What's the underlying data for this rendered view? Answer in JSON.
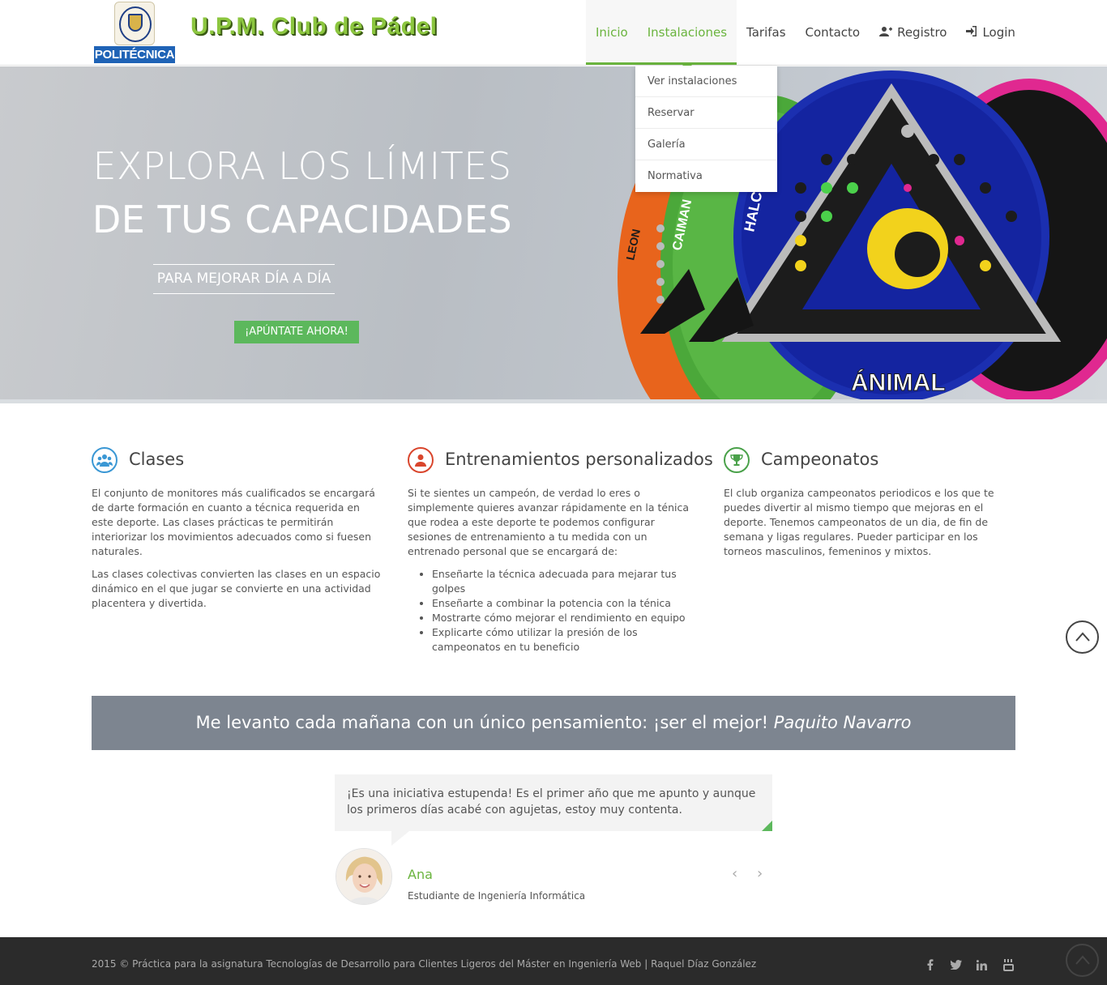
{
  "header": {
    "logo_text": "POLITÉCNICA",
    "brand": "U.P.M. Club de Pádel",
    "nav": [
      {
        "label": "Inicio"
      },
      {
        "label": "Instalaciones"
      },
      {
        "label": "Tarifas"
      },
      {
        "label": "Contacto"
      },
      {
        "label": "Registro",
        "icon": "user-plus-icon"
      },
      {
        "label": "Login",
        "icon": "sign-in-icon"
      }
    ],
    "dropdown": [
      "Ver instalaciones",
      "Reservar",
      "Galería",
      "Normativa"
    ]
  },
  "hero": {
    "title_line1": "EXPLORA LOS LÍMITES",
    "title_line2": "DE TUS CAPACIDADES",
    "subtitle": "PARA MEJORAR DÍA A DÍA",
    "cta": "¡APÚNTATE AHORA!",
    "racquet_brand": "ÁNIMAL",
    "racquet_labels": [
      "LEON",
      "CAIMAN",
      "HALCON"
    ]
  },
  "features": [
    {
      "title": "Clases",
      "icon": "users-icon",
      "color": "#3a97d4",
      "paragraphs": [
        "El conjunto de monitores más cualificados se encargará de darte formación en cuanto a técnica requerida en este deporte. Las clases prácticas te permitirán interiorizar los movimientos adecuados como si fuesen naturales.",
        "Las clases colectivas convierten las clases en un espacio dinámico en el que jugar se convierte en una actividad placentera y divertida."
      ]
    },
    {
      "title": "Entrenamientos personalizados",
      "icon": "user-icon",
      "color": "#d9452c",
      "paragraphs": [
        "Si te sientes un campeón, de verdad lo eres o simplemente quieres avanzar rápidamente en la ténica que rodea a este deporte te podemos configurar sesiones de entrenamiento a tu medida con un entrenado personal que se encargará de:"
      ],
      "list": [
        "Enseñarte la técnica adecuada para mejarar tus golpes",
        "Enseñarte a combinar la potencia con la ténica",
        "Mostrarte cómo mejorar el rendimiento en equipo",
        "Explicarte cómo utilizar la presión de los campeonatos en tu beneficio"
      ]
    },
    {
      "title": "Campeonatos",
      "icon": "trophy-icon",
      "color": "#4aa14a",
      "paragraphs": [
        "El club organiza campeonatos periodicos e los que te puedes divertir al mismo tiempo que mejoras en el deporte. Tenemos campeonatos de un dia, de fin de semana y ligas regulares. Pueder participar en los torneos masculinos, femeninos y mixtos."
      ]
    }
  ],
  "quote": {
    "text": "Me levanto cada mañana con un único pensamiento: ¡ser el mejor! ",
    "author": "Paquito Navarro"
  },
  "testimonial": {
    "text": "¡Es una iniciativa estupenda! Es el primer año que me apunto y aunque los primeros días acabé con agujetas, estoy muy contenta.",
    "name": "Ana",
    "role": "Estudiante de Ingeniería Informática",
    "prev": "‹",
    "next": "›"
  },
  "footer": {
    "text": "2015 © Práctica para la asignatura Tecnologías de Desarrollo para Clientes Ligeros del Máster en Ingeniería Web | Raquel Díaz González",
    "social": [
      "f",
      "t",
      "in",
      "yt"
    ]
  },
  "colors": {
    "accent": "#6ab43e",
    "quote_band": "#7d8590",
    "footer": "#2b2b2b"
  }
}
